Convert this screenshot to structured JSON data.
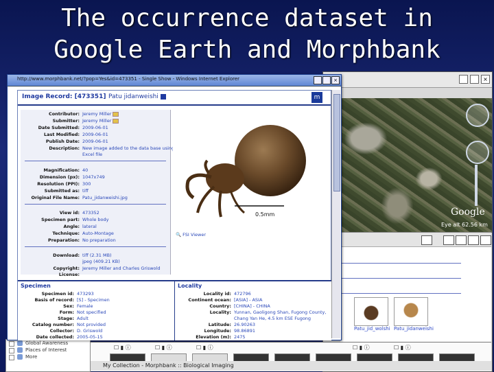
{
  "slide": {
    "title_line1": "The occurrence dataset in",
    "title_line2": "Google Earth and Morphbank"
  },
  "ie": {
    "title": "http://www.morphbank.net/?pop=Yes&id=473351 - Single Show - Windows Internet Explorer"
  },
  "record": {
    "title": "Image Record: [473351]",
    "author": "Patu jidanweishi",
    "logo": "m",
    "fields": [
      {
        "label": "Contributor:",
        "value": "Jeremy Miller"
      },
      {
        "label": "Submitter:",
        "value": "Jeremy Miller"
      },
      {
        "label": "Date Submitted:",
        "value": "2009-06-01"
      },
      {
        "label": "Last Modified:",
        "value": "2009-06-01"
      },
      {
        "label": "Publish Date:",
        "value": "2009-06-01"
      },
      {
        "label": "Description:",
        "value": "New image added to the data base using"
      },
      {
        "label": "",
        "value": "Excel file"
      }
    ],
    "fields2": [
      {
        "label": "Magnification:",
        "value": "40"
      },
      {
        "label": "Dimension (px):",
        "value": "1047x749"
      },
      {
        "label": "Resolution (PPI):",
        "value": "300"
      },
      {
        "label": "Submitted as:",
        "value": "tiff"
      },
      {
        "label": "Original File Name:",
        "value": "Patu_jidanweishi.jpg"
      }
    ],
    "fields3": [
      {
        "label": "View id:",
        "value": "473352"
      },
      {
        "label": "Specimen part:",
        "value": "Whole body"
      },
      {
        "label": "Angle:",
        "value": "lateral"
      },
      {
        "label": "Technique:",
        "value": "Auto-Montage"
      },
      {
        "label": "Preparation:",
        "value": "No preparation"
      }
    ],
    "fields4": [
      {
        "label": "Download:",
        "value": "tiff (2.31 MB)"
      },
      {
        "label": "",
        "value": "jpeg (409.21 KB)"
      },
      {
        "label": "Copyright:",
        "value": "Jeremy Miller and Charles Griswold"
      },
      {
        "label": "License:",
        "value": ""
      }
    ],
    "scale_label": "0.5mm",
    "viewer_link": "FSI Viewer"
  },
  "specimen": {
    "heading": "Specimen",
    "fields": [
      {
        "label": "Specimen id:",
        "value": "473293"
      },
      {
        "label": "Basis of record:",
        "value": "[S] - Specimen"
      },
      {
        "label": "Sex:",
        "value": "Female"
      },
      {
        "label": "Form:",
        "value": "Not specified"
      },
      {
        "label": "Stage:",
        "value": "Adult"
      },
      {
        "label": "Catalog number:",
        "value": "Not provided"
      },
      {
        "label": "Collector:",
        "value": "D. Griswold"
      },
      {
        "label": "Date collected:",
        "value": "2005-05-15"
      }
    ]
  },
  "locality": {
    "heading": "Locality",
    "fields": [
      {
        "label": "Locality id:",
        "value": "472796"
      },
      {
        "label": "Continent ocean:",
        "value": "[ASIA] - ASIA"
      },
      {
        "label": "Country:",
        "value": "[CHINA] - CHINA"
      },
      {
        "label": "Locality:",
        "value": "Yunnan, Gaoligong Shan, Fugong County,"
      },
      {
        "label": "",
        "value": "Chang Yan He, 4.5 km ESE Fugong"
      },
      {
        "label": "Latitude:",
        "value": "26.90263"
      },
      {
        "label": "Longitude:",
        "value": "98.86891"
      },
      {
        "label": "Elevation (m):",
        "value": "2475"
      }
    ]
  },
  "google_earth": {
    "logo": "Google",
    "eye_alt": "Eye alt  62.56 km"
  },
  "results": {
    "thumbs": [
      {
        "label": "Patu_jid_wolshi"
      },
      {
        "label": "Patu_jidanweishi"
      }
    ],
    "status": "My Collection - Morphbank :: Biological Imaging"
  },
  "left_panel": {
    "items": [
      "Global Awareness",
      "Places of Interest",
      "More"
    ]
  },
  "colors": {
    "accent": "#1f3aa0",
    "link": "#2846b8",
    "title_bar": "#5f86d4"
  }
}
